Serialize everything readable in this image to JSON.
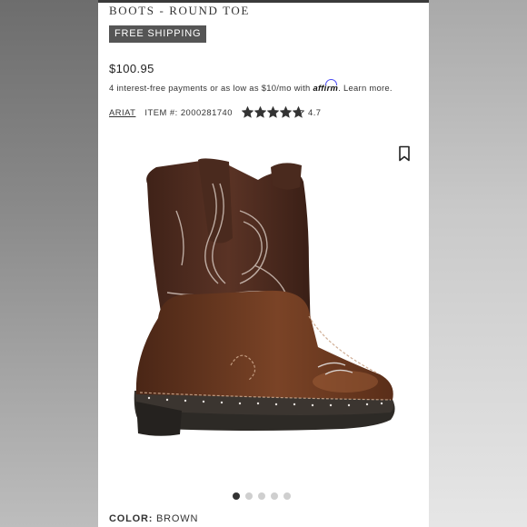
{
  "category_title": "BOOTS - ROUND TOE",
  "free_shipping_label": "FREE SHIPPING",
  "price": "$100.95",
  "payment": {
    "text": "4 interest-free payments or as low as $10/mo with",
    "provider": "affirm",
    "learn_more": "Learn more."
  },
  "product": {
    "brand": "ARIAT",
    "item_number": "ITEM #: 2000281740",
    "rating": 4.7,
    "rating_text": "4.7",
    "max_stars": 5
  },
  "gallery": {
    "slide_count": 5,
    "active_slide": 1,
    "image_icon": "boot-photo"
  },
  "color": {
    "label": "COLOR:",
    "value": "BROWN"
  },
  "icons": {
    "bookmark": "bookmark-icon",
    "star": "star-icon"
  },
  "colors": {
    "badge_bg": "#555555",
    "star": "#333333",
    "affirm_arc": "#4a4af4",
    "boot_leather": "#6b3a22",
    "boot_shaft": "#4e2b1f"
  }
}
